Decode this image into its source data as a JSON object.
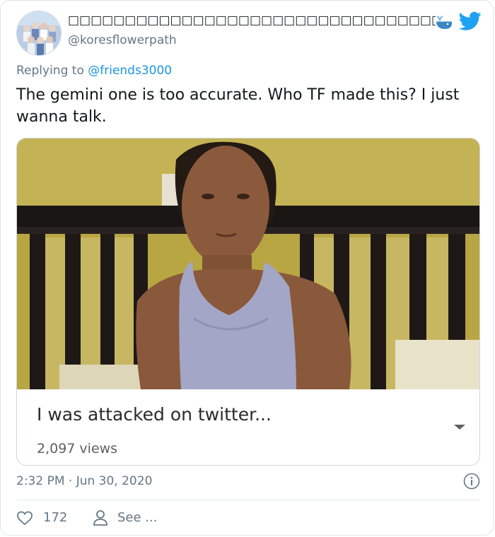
{
  "tweet": {
    "display_name": "□□□□□□□□□□□□□□□□□□□□□□□□□□□□□□□□□□□□□□□□□□□□□□□□⁷ |",
    "handle": "@koresflowerpath",
    "reply_prefix": "Replying to ",
    "reply_to": "@friends3000",
    "text": "The gemini one is too accurate. Who TF made this? I just wanna talk.",
    "timestamp": "2:32 PM · Jun 30, 2020",
    "like_count": "172",
    "see_label": "See ..."
  },
  "media": {
    "video_title": "I was attacked on twitter...",
    "views": "2,097 views"
  },
  "icons": {
    "whale": "whale-icon",
    "bird": "twitter-bird-icon",
    "info": "info-icon",
    "like": "heart-icon",
    "profile": "person-icon",
    "dropdown": "chevron-down-icon"
  },
  "colors": {
    "twitter_blue": "#1da1f2",
    "link_blue": "#1b95e0",
    "secondary_text": "#657786"
  }
}
